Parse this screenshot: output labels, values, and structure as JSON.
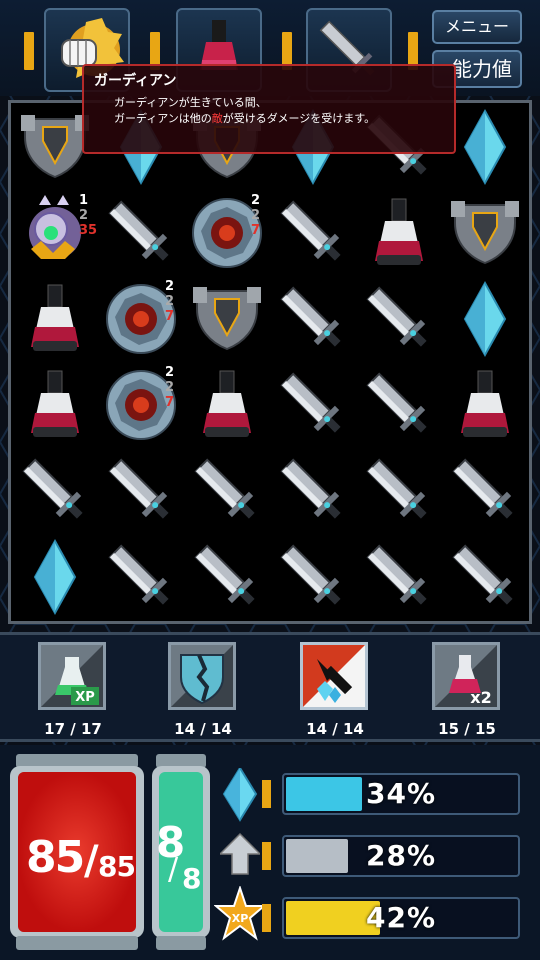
{
  "menu": {
    "menu_label": "メニュー",
    "stats_label": "能力値"
  },
  "tooltip": {
    "title": "ガーディアン",
    "line1": "ガーディアンが生きている間、",
    "line2_a": "ガーディアンは他の",
    "line2_red": "敵",
    "line2_b": "が受けるダメージを受けます。"
  },
  "board": {
    "rows": [
      [
        "guardian",
        "crystal",
        "guardian",
        "crystal",
        "sword",
        "crystal"
      ],
      [
        "enemy-boss",
        "sword",
        "vortex",
        "sword",
        "potion",
        "guardian"
      ],
      [
        "potion",
        "vortex",
        "guardian",
        "sword",
        "sword",
        "crystal"
      ],
      [
        "potion",
        "vortex",
        "potion",
        "sword",
        "sword",
        "potion"
      ],
      [
        "sword",
        "sword",
        "sword",
        "sword",
        "sword",
        "sword"
      ],
      [
        "crystal",
        "sword",
        "sword",
        "sword",
        "sword",
        "sword"
      ]
    ],
    "enemy_stats": [
      {
        "row": 1,
        "col": 0,
        "a": "1",
        "b": "2",
        "c": "35"
      },
      {
        "row": 1,
        "col": 2,
        "a": "2",
        "b": "2",
        "c": "7"
      },
      {
        "row": 2,
        "col": 1,
        "a": "2",
        "b": "2",
        "c": "7"
      },
      {
        "row": 3,
        "col": 1,
        "a": "2",
        "b": "2",
        "c": "7"
      }
    ]
  },
  "skills": [
    {
      "name": "xp-potion-skill",
      "count": "17 / 17"
    },
    {
      "name": "broken-shield-skill",
      "count": "14 / 14"
    },
    {
      "name": "crystal-slash-skill",
      "count": "14 / 14"
    },
    {
      "name": "double-potion-skill",
      "count": "15 / 15"
    }
  ],
  "skill_labels": {
    "xp": "XP",
    "x2": "x2"
  },
  "hp": {
    "current": "85",
    "slash": "/",
    "max": "85"
  },
  "mp": {
    "current": "8",
    "slash": "/",
    "max": "8"
  },
  "bars": [
    {
      "icon": "crystal-icon",
      "percent": 34,
      "label": "34%",
      "color": "#3cc6e6"
    },
    {
      "icon": "up-arrow-icon",
      "percent": 28,
      "label": "28%",
      "color": "#b6bec6"
    },
    {
      "icon": "xp-star-icon",
      "percent": 42,
      "label": "42%",
      "color": "#f0d020"
    }
  ],
  "xp_badge": "XP",
  "colors": {
    "accent": "#e8a614",
    "enemy_red": "#e0322c",
    "tooltip_border": "#b52a2a"
  }
}
